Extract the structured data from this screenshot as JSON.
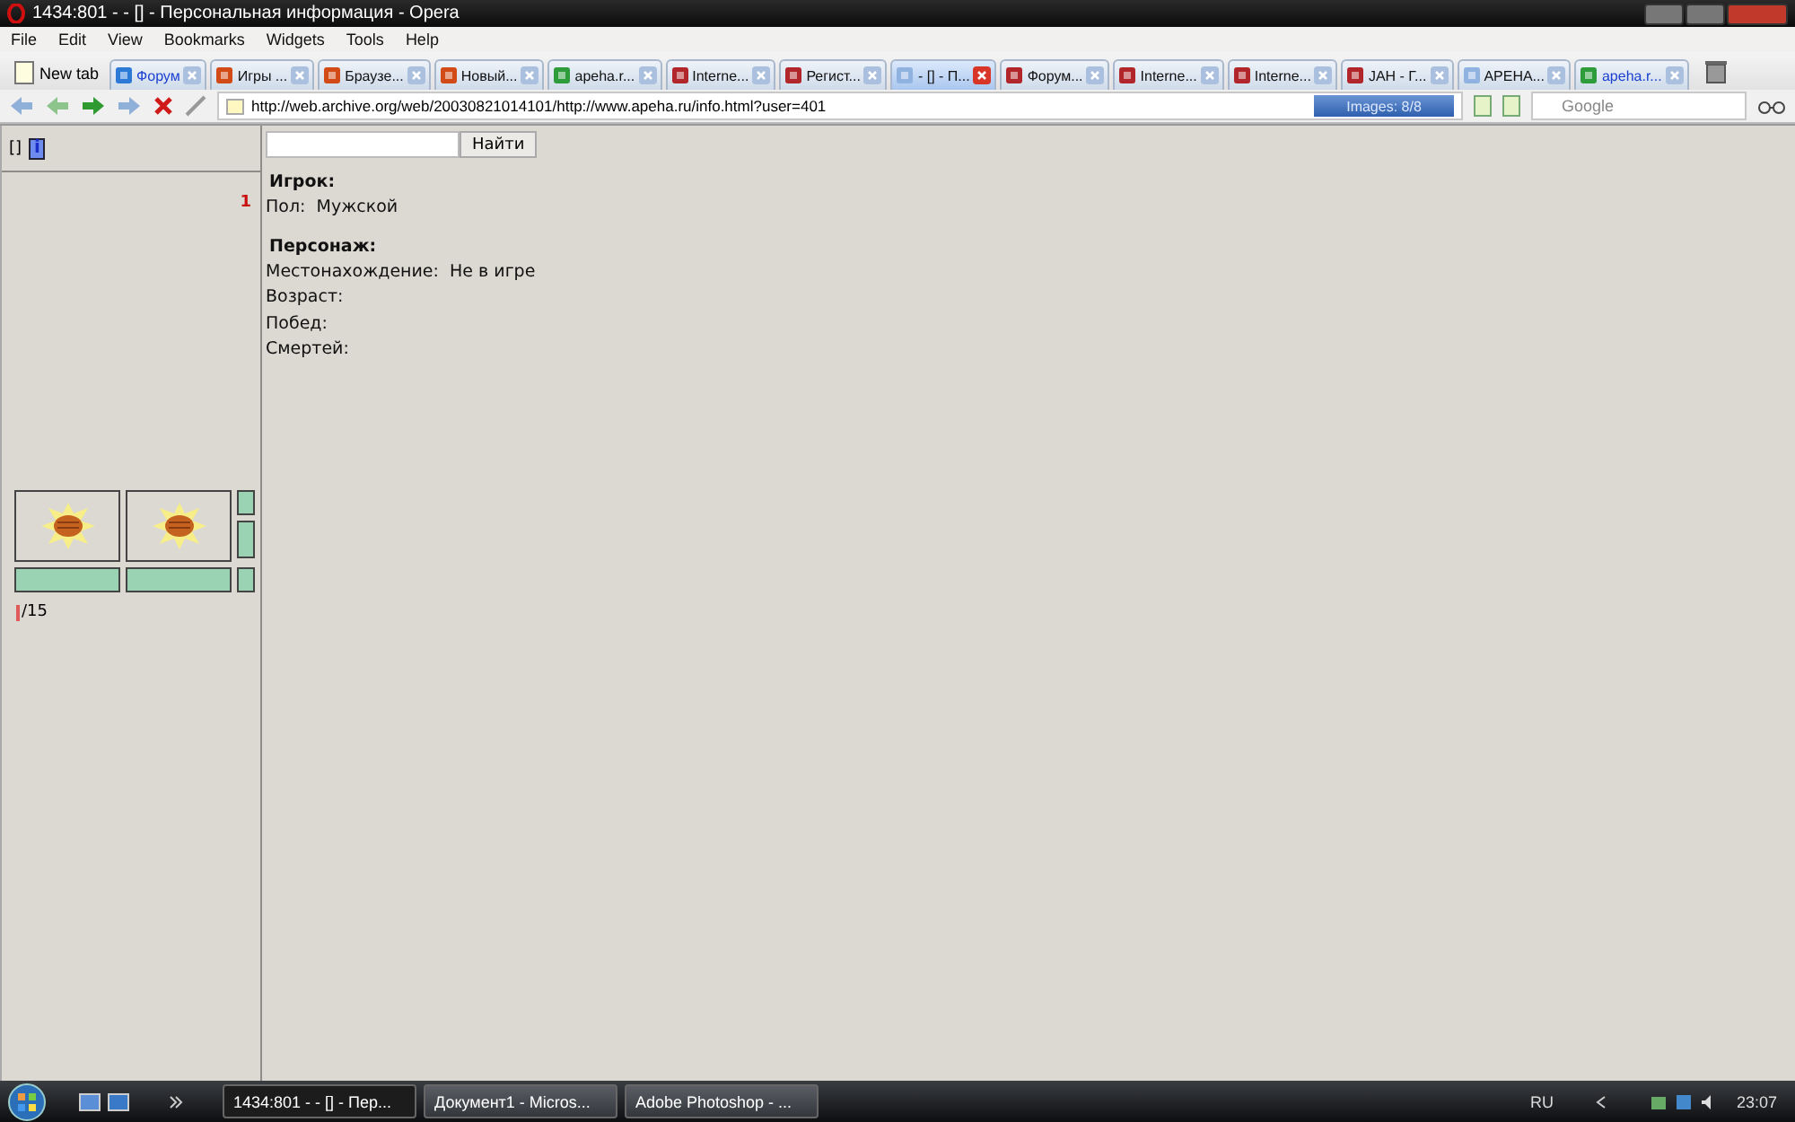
{
  "window": {
    "title": "1434:801 - - [] - Персональная информация - Opera"
  },
  "menu": [
    "File",
    "Edit",
    "View",
    "Bookmarks",
    "Widgets",
    "Tools",
    "Help"
  ],
  "new_tab": "New tab",
  "tabs": [
    {
      "label": "Форум",
      "selected": false,
      "kind": "globe"
    },
    {
      "label": "Игры ...",
      "selected": false,
      "kind": "game"
    },
    {
      "label": "Браузе...",
      "selected": false,
      "kind": "game"
    },
    {
      "label": "Новый...",
      "selected": false,
      "kind": "game"
    },
    {
      "label": "apeha.r...",
      "selected": false,
      "kind": "google"
    },
    {
      "label": "Interne...",
      "selected": false,
      "kind": "archive"
    },
    {
      "label": "Регист...",
      "selected": false,
      "kind": "archive"
    },
    {
      "label": "- [] - П...",
      "selected": true,
      "kind": "page"
    },
    {
      "label": "Форум...",
      "selected": false,
      "kind": "archive"
    },
    {
      "label": "Interne...",
      "selected": false,
      "kind": "archive"
    },
    {
      "label": "Interne...",
      "selected": false,
      "kind": "archive"
    },
    {
      "label": "JAH - Г...",
      "selected": false,
      "kind": "archive"
    },
    {
      "label": "APEHA...",
      "selected": false,
      "kind": "page"
    },
    {
      "label": "apeha.r...",
      "selected": false,
      "kind": "google"
    }
  ],
  "address": {
    "url": "http://web.archive.org/web/20030821014101/http://www.apeha.ru/info.html?user=401",
    "images": "Images:  8/8"
  },
  "search": {
    "placeholder": "Google"
  },
  "sidebar": {
    "brackets": "[]",
    "info": "i",
    "number": "1",
    "count": "/15"
  },
  "page": {
    "find_button": "Найти",
    "sections": [
      {
        "heading": "Игрок:",
        "rows": [
          {
            "label": "Пол:",
            "value": "Мужской"
          }
        ]
      },
      {
        "heading": "Персонаж:",
        "rows": [
          {
            "label": "Местонахождение:",
            "value": "Не в игре"
          },
          {
            "label": "Возраст:"
          },
          {
            "label": "Побед:"
          },
          {
            "label": "Смертей:"
          }
        ]
      }
    ]
  },
  "taskbar": {
    "items": [
      {
        "label": "1434:801 - - [] - Пер...",
        "selected": true
      },
      {
        "label": "Документ1 - Micros...",
        "selected": false
      },
      {
        "label": "Adobe Photoshop - ...",
        "selected": false
      }
    ],
    "language": "RU",
    "time": "23:07"
  }
}
